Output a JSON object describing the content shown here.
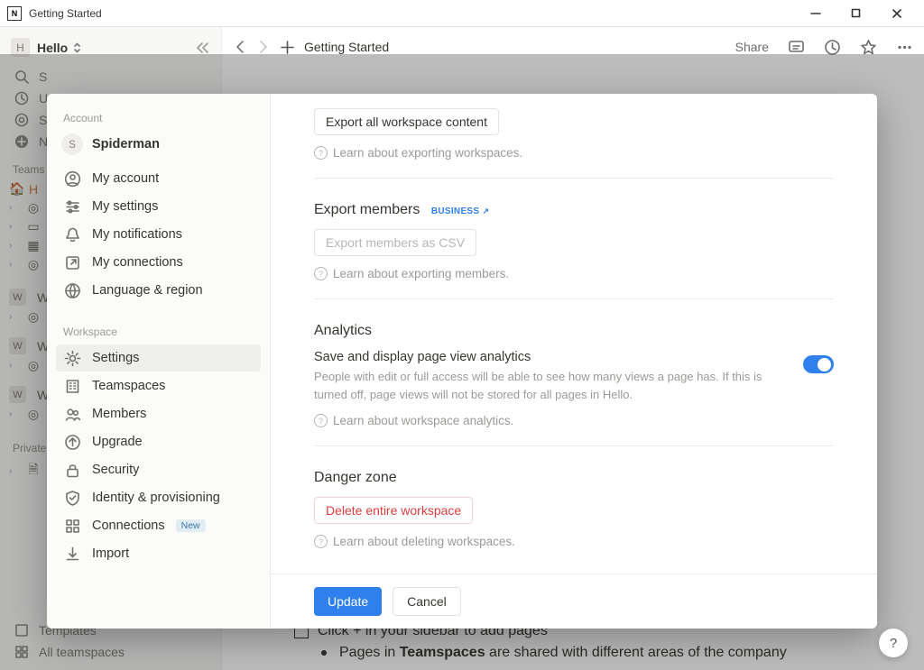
{
  "window": {
    "title": "Getting Started"
  },
  "sidebar": {
    "workspace_avatar": "H",
    "workspace_name": "Hello",
    "quick": [
      {
        "label": "S"
      },
      {
        "label": "U"
      },
      {
        "label": "S"
      },
      {
        "label": "N"
      }
    ],
    "section_teams": "Teams",
    "team_initial": "H",
    "private_label": "Private",
    "templates_label": "Templates",
    "allteamspaces_label": "All teamspaces"
  },
  "topbar": {
    "crumb": "Getting Started",
    "share": "Share"
  },
  "bg_content": {
    "line1": "Click + in your sidebar to add pages",
    "line2_a": "Pages in ",
    "line2_b": "Teamspaces",
    "line2_c": " are shared with different areas of the company"
  },
  "modal": {
    "account_label": "Account",
    "user_avatar": "S",
    "user_name": "Spiderman",
    "account_items": [
      "My account",
      "My settings",
      "My notifications",
      "My connections",
      "Language & region"
    ],
    "workspace_label": "Workspace",
    "workspace_items": [
      "Settings",
      "Teamspaces",
      "Members",
      "Upgrade",
      "Security",
      "Identity & provisioning",
      "Connections",
      "Import"
    ],
    "new_badge": "New",
    "settings": {
      "export_btn": "Export all workspace content",
      "learn_export": "Learn about exporting workspaces.",
      "export_members_h": "Export members",
      "business_badge": "BUSINESS",
      "export_csv_btn": "Export members as CSV",
      "learn_members": "Learn about exporting members.",
      "analytics_h": "Analytics",
      "analytics_sub": "Save and display page view analytics",
      "analytics_desc": "People with edit or full access will be able to see how many views a page has. If this is turned off, page views will not be stored for all pages in Hello.",
      "learn_analytics": "Learn about workspace analytics.",
      "danger_h": "Danger zone",
      "delete_btn": "Delete entire workspace",
      "learn_delete": "Learn about deleting workspaces."
    },
    "footer": {
      "update": "Update",
      "cancel": "Cancel"
    }
  }
}
